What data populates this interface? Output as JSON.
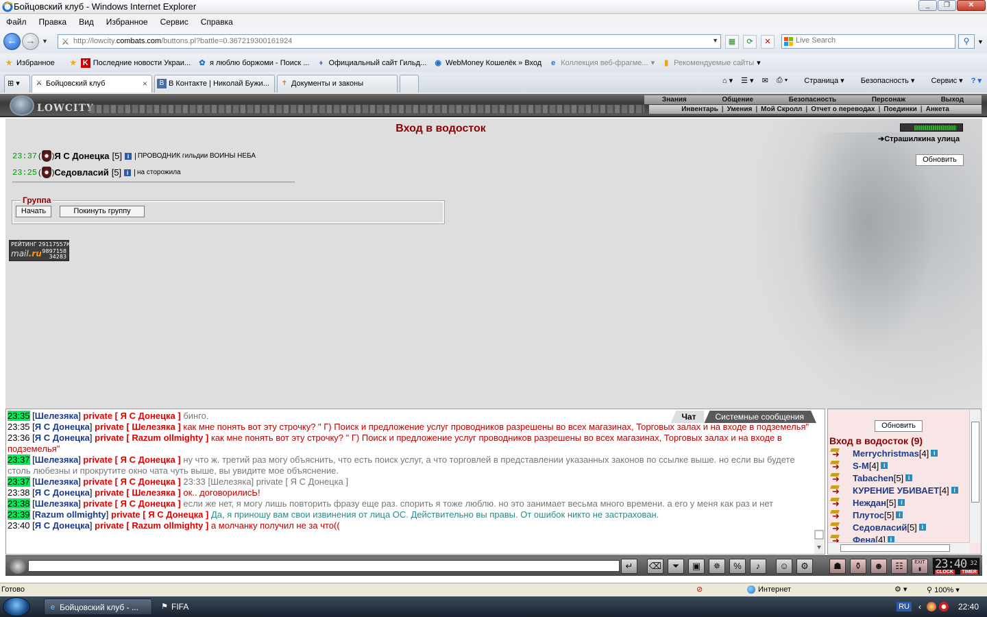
{
  "window": {
    "title": "Бойцовский клуб - Windows Internet Explorer"
  },
  "menu": [
    "Файл",
    "Правка",
    "Вид",
    "Избранное",
    "Сервис",
    "Справка"
  ],
  "address": {
    "url_prefix": "http://lowcity.",
    "url_domain": "combats.com",
    "url_suffix": "/buttons.pl?battle=0.367219300161924"
  },
  "search": {
    "placeholder": "Live Search"
  },
  "favorites": {
    "label": "Избранное",
    "items": [
      "Последние новости Украи...",
      "я люблю боржоми - Поиск ...",
      "Официальный сайт Гильд...",
      "WebMoney Кошелёк » Вход",
      "Коллекция веб-фрагме...",
      "Рекомендуемые сайты"
    ]
  },
  "tabs": [
    {
      "label": "Бойцовский клуб",
      "close": "×"
    },
    {
      "label": "В Контакте | Николай Бужи..."
    },
    {
      "label": "Документы и законы"
    }
  ],
  "cmdbar": {
    "page": "Страница",
    "security": "Безопасность",
    "service": "Сервис"
  },
  "game": {
    "logo": "LOWCITY",
    "topnav": [
      "Знания",
      "Общение",
      "Безопасность",
      "Персонаж",
      "Выход"
    ],
    "subnav": [
      "Инвентарь",
      "Умения",
      "Мой Скролл",
      "Отчет о переводах",
      "Поединки",
      "Анкета"
    ],
    "location_title": "Вход в водосток",
    "location_link": "Страшилкина улица",
    "refresh_label": "Обновить",
    "location_progress": 0.85,
    "players": [
      {
        "time": "23:37",
        "name": "Я С Донецка",
        "level": "[5]",
        "sep": "|",
        "status": "ПРОВОДНИК гильдии ВОИНЫ НЕБА"
      },
      {
        "time": "23:25",
        "name": "Седовласий",
        "level": "[5]",
        "sep": "|",
        "status": "на сторожила"
      }
    ],
    "group": {
      "legend": "Группа",
      "start": "Начать",
      "leave": "Покинуть группу"
    },
    "mailru": {
      "rating": "РЕЙТИНГ 29117557К",
      "n1": "9897158",
      "n2": "34283",
      "logo1": "mail",
      "logo2": ".ru"
    }
  },
  "chat": {
    "tabs": {
      "chat": "Чат",
      "system": "Системные сообщения"
    },
    "lines": [
      {
        "time": "23:35",
        "hl": true,
        "nick": "Шелезяка",
        "to": "Я С Донецка",
        "text": "бинго.",
        "cls": "msg-g"
      },
      {
        "time": "23:35",
        "hl": false,
        "nick": "Я С Донецка",
        "to": "Шелезяка",
        "text": "как мне понять вот эту строчку? \" Г) Поиск и предложение услуг проводников разрешены во всех магазинах, Торговых залах и на входе в подземелья\"",
        "cls": "msg-r"
      },
      {
        "time": "23:36",
        "hl": false,
        "nick": "Я С Донецка",
        "to": "Razum ollmighty",
        "text": "как мне понять вот эту строчку? \" Г) Поиск и предложение услуг проводников разрешены во всех магазинах, Торговых залах и на входе в подземелья\"",
        "cls": "msg-r"
      },
      {
        "time": "23:37",
        "hl": true,
        "nick": "Шелезяка",
        "to": "Я С Донецка",
        "text": "ну что ж. третий раз могу объяснить, что есть поиск услуг, а что торговлей в представлении указанных законов по ссылке выше. но если вы будете столь любезны и прокрутите окно чата чуть выше, вы увидите мое объяснение.",
        "cls": "msg-g"
      },
      {
        "time": "23:37",
        "hl": true,
        "nick": "Шелезяка",
        "to": "Я С Донецка",
        "text": "23:33 [Шелезяка] private [ Я С Донецка ]",
        "cls": "msg-g"
      },
      {
        "time": "23:38",
        "hl": false,
        "nick": "Я С Донецка",
        "to": "Шелезяка",
        "text": "ок.. договорилисЬ!",
        "cls": "msg-r"
      },
      {
        "time": "23:38",
        "hl": true,
        "nick": "Шелезяка",
        "to": "Я С Донецка",
        "text": "если же нет, я могу лишь повторить фразу еще раз. спорить я тоже люблю. но это занимает весьма много времени. а его у меня как раз и нет",
        "cls": "msg-g"
      },
      {
        "time": "23:39",
        "hl": true,
        "nick": "Razum ollmighty",
        "to": "Я С Донецка",
        "text": "Да, я приношу вам свои извинения от лица ОС. Действительно вы правы. От ошибок никто не застрахован.",
        "cls": "msg-t"
      },
      {
        "time": "23:40",
        "hl": false,
        "nick": "Я С Донецка",
        "to": "Razum ollmighty",
        "text": "а молчанку получил не за что((",
        "cls": "msg-r"
      }
    ],
    "private_word": "private"
  },
  "userlist": {
    "refresh": "Обновить",
    "title": "Вход в водосток (9)",
    "users": [
      {
        "name": "Merrychristmas",
        "level": "[4]"
      },
      {
        "name": "S-M",
        "level": "[4]"
      },
      {
        "name": "Tabachen",
        "level": "[5]"
      },
      {
        "name": "КУРЕНИЕ УБИВАЕТ",
        "level": "[4]"
      },
      {
        "name": "Неждан",
        "level": "[5]"
      },
      {
        "name": "Плутос",
        "level": "[5]"
      },
      {
        "name": "Седовласий",
        "level": "[5]"
      },
      {
        "name": "Фена",
        "level": "[4]"
      }
    ]
  },
  "clock": {
    "time": "23:40",
    "sec": "32",
    "label1": "CLOCK",
    "label2": "TIMER",
    "exit": "EXIT"
  },
  "status": {
    "left": "Готово",
    "zone": "Интернет",
    "zoom": "100%"
  },
  "taskbar": {
    "items": [
      "Бойцовский клуб - ...",
      "FIFA"
    ],
    "lang": "RU",
    "time": "22:40"
  },
  "colors": {
    "location_title": "#8b0000",
    "nick": "#1b3a8c",
    "private": "#e00000",
    "time_highlight": "#00ee55"
  }
}
